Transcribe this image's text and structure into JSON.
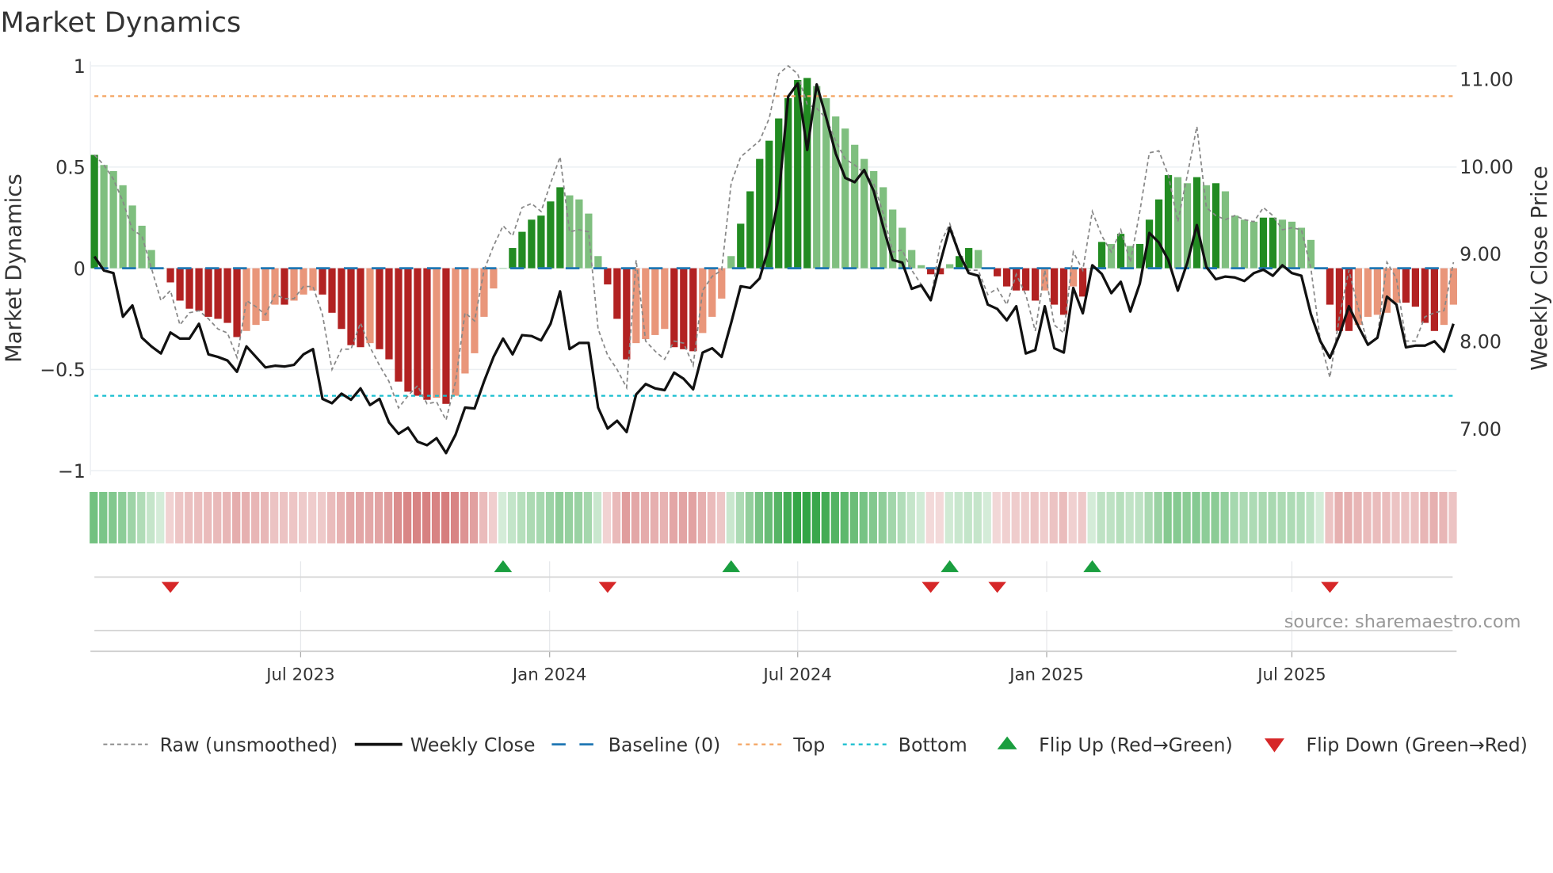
{
  "chart_data": {
    "type": "bar",
    "title": "Market Dynamics",
    "ylabel": "Market Dynamics",
    "y2label": "Weekly Close Price",
    "ylim": [
      -1,
      1
    ],
    "y2lim": [
      6.5,
      11.2
    ],
    "yticks": [
      {
        "v": 1,
        "label": "1"
      },
      {
        "v": 0.5,
        "label": "0.5"
      },
      {
        "v": 0,
        "label": "0"
      },
      {
        "v": -0.5,
        "label": "−0.5"
      },
      {
        "v": -1,
        "label": "−1"
      }
    ],
    "y2ticks": [
      {
        "v": 11,
        "label": "11.00"
      },
      {
        "v": 10,
        "label": "10.00"
      },
      {
        "v": 9,
        "label": "9.00"
      },
      {
        "v": 8,
        "label": "8.00"
      },
      {
        "v": 7,
        "label": "7.00"
      }
    ],
    "xticks": [
      {
        "week": 21.7,
        "label": "Jul 2023"
      },
      {
        "week": 47.9,
        "label": "Jan 2024"
      },
      {
        "week": 74.0,
        "label": "Jul 2024"
      },
      {
        "week": 100.2,
        "label": "Jan 2025"
      },
      {
        "week": 126.0,
        "label": "Jul 2025"
      }
    ],
    "grid": true,
    "legend_position": "bottom",
    "levels": {
      "baseline": 0,
      "top": 0.85,
      "bottom": -0.63
    },
    "momentum": [
      0.56,
      0.51,
      0.48,
      0.41,
      0.31,
      0.21,
      0.09,
      0.0,
      -0.07,
      -0.16,
      -0.2,
      -0.21,
      -0.24,
      -0.25,
      -0.27,
      -0.34,
      -0.31,
      -0.28,
      -0.26,
      -0.18,
      -0.18,
      -0.16,
      -0.13,
      -0.11,
      -0.13,
      -0.22,
      -0.3,
      -0.38,
      -0.39,
      -0.37,
      -0.4,
      -0.45,
      -0.56,
      -0.61,
      -0.63,
      -0.65,
      -0.64,
      -0.67,
      -0.63,
      -0.52,
      -0.42,
      -0.24,
      -0.1,
      0.0,
      0.1,
      0.18,
      0.24,
      0.26,
      0.33,
      0.4,
      0.36,
      0.34,
      0.27,
      0.06,
      -0.08,
      -0.25,
      -0.45,
      -0.37,
      -0.35,
      -0.33,
      -0.3,
      -0.39,
      -0.4,
      -0.41,
      -0.32,
      -0.24,
      -0.15,
      0.06,
      0.22,
      0.38,
      0.54,
      0.63,
      0.74,
      0.84,
      0.93,
      0.94,
      0.9,
      0.84,
      0.75,
      0.69,
      0.61,
      0.54,
      0.48,
      0.4,
      0.29,
      0.2,
      0.09,
      0.015,
      -0.03,
      -0.03,
      0.02,
      0.06,
      0.1,
      0.09,
      0.0,
      -0.04,
      -0.09,
      -0.11,
      -0.11,
      -0.16,
      -0.11,
      -0.18,
      -0.23,
      -0.09,
      -0.14,
      0.0,
      0.13,
      0.12,
      0.17,
      0.11,
      0.12,
      0.24,
      0.34,
      0.46,
      0.45,
      0.42,
      0.45,
      0.41,
      0.42,
      0.38,
      0.26,
      0.24,
      0.23,
      0.25,
      0.25,
      0.24,
      0.23,
      0.2,
      0.14,
      0.0,
      -0.18,
      -0.31,
      -0.31,
      -0.28,
      -0.24,
      -0.23,
      -0.22,
      -0.17,
      -0.17,
      -0.19,
      -0.27,
      -0.31,
      -0.28,
      -0.18
    ],
    "raw": [
      0.56,
      0.51,
      0.44,
      0.33,
      0.19,
      0.16,
      0.0,
      -0.16,
      -0.11,
      -0.28,
      -0.22,
      -0.21,
      -0.25,
      -0.3,
      -0.32,
      -0.44,
      -0.16,
      -0.19,
      -0.23,
      -0.13,
      -0.15,
      -0.15,
      -0.09,
      -0.09,
      -0.23,
      -0.5,
      -0.4,
      -0.4,
      -0.27,
      -0.39,
      -0.48,
      -0.56,
      -0.69,
      -0.63,
      -0.58,
      -0.67,
      -0.66,
      -0.75,
      -0.56,
      -0.22,
      -0.26,
      -0.01,
      0.11,
      0.21,
      0.16,
      0.3,
      0.32,
      0.28,
      0.42,
      0.55,
      0.18,
      0.19,
      0.18,
      -0.3,
      -0.43,
      -0.5,
      -0.59,
      0.04,
      -0.36,
      -0.41,
      -0.45,
      -0.36,
      -0.37,
      -0.48,
      -0.11,
      -0.04,
      -0.01,
      0.42,
      0.55,
      0.59,
      0.63,
      0.74,
      0.96,
      1.0,
      0.96,
      0.81,
      0.79,
      0.74,
      0.63,
      0.54,
      0.51,
      0.47,
      0.42,
      0.27,
      0.08,
      0.09,
      -0.01,
      -0.08,
      -0.15,
      0.12,
      0.22,
      0.08,
      -0.01,
      -0.01,
      -0.13,
      -0.1,
      -0.18,
      -0.03,
      -0.13,
      -0.31,
      -0.01,
      -0.28,
      -0.32,
      0.08,
      -0.01,
      0.28,
      0.16,
      0.08,
      0.19,
      0.03,
      0.28,
      0.57,
      0.58,
      0.46,
      0.23,
      0.46,
      0.7,
      0.3,
      0.26,
      0.24,
      0.26,
      0.24,
      0.23,
      0.3,
      0.26,
      0.19,
      0.2,
      0.19,
      0.0,
      -0.36,
      -0.54,
      -0.24,
      -0.01,
      -0.2,
      -0.38,
      -0.34,
      0.03,
      -0.05,
      -0.36,
      -0.36,
      -0.24,
      -0.22,
      -0.21,
      0.03
    ],
    "close": [
      8.97,
      8.81,
      8.78,
      8.28,
      8.41,
      8.04,
      7.94,
      7.86,
      8.1,
      8.03,
      8.03,
      8.2,
      7.85,
      7.82,
      7.78,
      7.65,
      7.94,
      7.82,
      7.7,
      7.72,
      7.71,
      7.73,
      7.85,
      7.91,
      7.34,
      7.29,
      7.4,
      7.33,
      7.46,
      7.27,
      7.34,
      7.07,
      6.94,
      7.01,
      6.85,
      6.81,
      6.89,
      6.72,
      6.93,
      7.24,
      7.23,
      7.54,
      7.82,
      8.03,
      7.85,
      8.07,
      8.06,
      8.01,
      8.2,
      8.57,
      7.91,
      7.98,
      7.98,
      7.24,
      7.0,
      7.09,
      6.96,
      7.39,
      7.51,
      7.46,
      7.44,
      7.64,
      7.57,
      7.45,
      7.87,
      7.92,
      7.82,
      8.21,
      8.63,
      8.61,
      8.72,
      9.09,
      9.65,
      10.8,
      10.95,
      10.19,
      10.94,
      10.56,
      10.15,
      9.87,
      9.82,
      9.96,
      9.72,
      9.31,
      8.93,
      8.9,
      8.6,
      8.64,
      8.47,
      8.9,
      9.3,
      9.0,
      8.78,
      8.75,
      8.42,
      8.37,
      8.24,
      8.4,
      7.86,
      7.9,
      8.4,
      7.92,
      7.87,
      8.61,
      8.32,
      8.87,
      8.77,
      8.55,
      8.68,
      8.34,
      8.66,
      9.24,
      9.13,
      8.93,
      8.58,
      8.9,
      9.33,
      8.85,
      8.71,
      8.74,
      8.73,
      8.69,
      8.78,
      8.82,
      8.75,
      8.87,
      8.78,
      8.75,
      8.31,
      8.0,
      7.81,
      8.07,
      8.4,
      8.17,
      7.96,
      8.04,
      8.51,
      8.42,
      7.93,
      7.95,
      7.95,
      8.0,
      7.88,
      8.2
    ],
    "flip_up_weeks": [
      43,
      67,
      90,
      105
    ],
    "flip_down_weeks": [
      8,
      54,
      88,
      95,
      130
    ],
    "legend": [
      "Raw (unsmoothed)",
      "Weekly Close",
      "Baseline (0)",
      "Top",
      "Bottom",
      "Flip Up (Red→Green)",
      "Flip Down (Green→Red)"
    ],
    "source": "source: sharemaestro.com",
    "colors": {
      "up_strong": "#228b22",
      "up_weak": "#7fbf7f",
      "down_strong": "#b22222",
      "down_weak": "#e9967a",
      "raw": "#888888",
      "close": "#111111",
      "baseline": "#1f77b4",
      "top": "#f4a460",
      "bottom": "#17becf",
      "flip_up": "#1a9e3f",
      "flip_down": "#d62728"
    }
  }
}
